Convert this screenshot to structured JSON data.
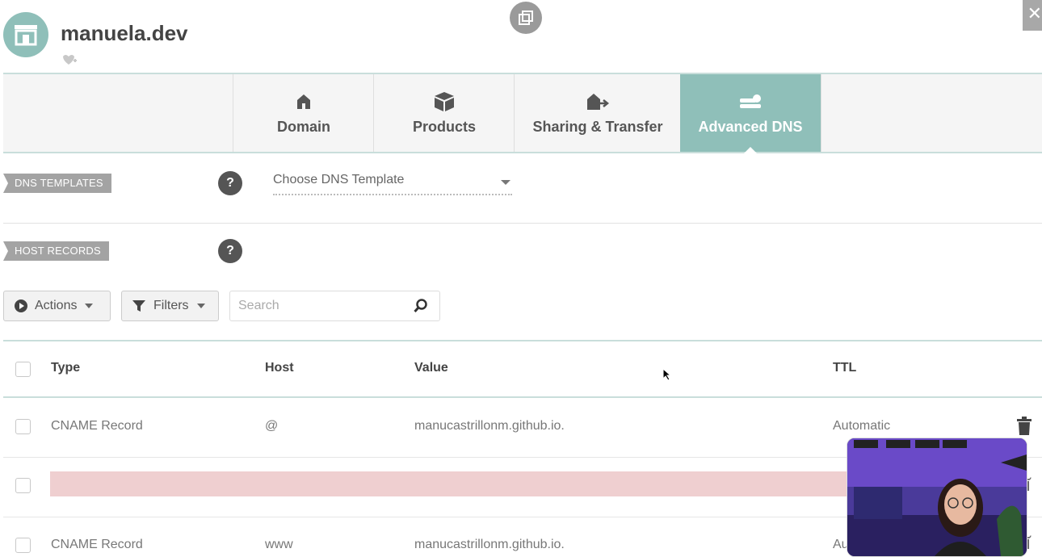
{
  "site": {
    "title": "manuela.dev"
  },
  "tabs": [
    {
      "label": "Domain",
      "icon": "home-icon",
      "active": false
    },
    {
      "label": "Products",
      "icon": "box-icon",
      "active": false
    },
    {
      "label": "Sharing & Transfer",
      "icon": "transfer-icon",
      "active": false
    },
    {
      "label": "Advanced DNS",
      "icon": "dns-icon",
      "active": true
    }
  ],
  "dns_templates": {
    "tag": "DNS TEMPLATES",
    "help": "?",
    "select_value": "Choose DNS Template"
  },
  "host_records": {
    "tag": "HOST RECORDS",
    "help": "?"
  },
  "toolbar": {
    "actions_label": "Actions",
    "filters_label": "Filters",
    "search_placeholder": "Search"
  },
  "table": {
    "headers": {
      "type": "Type",
      "host": "Host",
      "value": "Value",
      "ttl": "TTL"
    },
    "rows": [
      {
        "type": "CNAME Record",
        "host": "@",
        "value": "manucastrillonm.github.io.",
        "ttl": "Automatic"
      },
      {
        "type": "",
        "host": "",
        "value": "",
        "ttl": "",
        "state": "deleted"
      },
      {
        "type": "CNAME Record",
        "host": "www",
        "value": "manucastrillonm.github.io.",
        "ttl": "Au"
      }
    ]
  },
  "colors": {
    "accent": "#8fbfb9",
    "deleted_row": "#efcfd0",
    "tag_bg": "#a3a3a3"
  }
}
